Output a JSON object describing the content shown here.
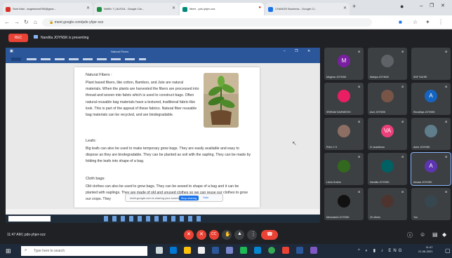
{
  "browser": {
    "tabs": [
      {
        "label": "Sent Mail - angelsmart786@gma..."
      },
      {
        "label": "Netflix 7 | ALEXA - Google Cla..."
      },
      {
        "label": "Meet - pdx-yhjer-ozz",
        "active": true
      },
      {
        "label": "CHANGE Business - Google Cl..."
      }
    ],
    "url": "meet.google.com/pdx-yhjer-ozz"
  },
  "meet": {
    "rec_label": "REC",
    "presenting_text": "Nandita JOYNSK is presenting",
    "meeting_info": "11:47 AM | pdx-yhjer-ozz",
    "share_banner": {
      "message": "meet.google.com is sharing your screen.",
      "stop_label": "Stop sharing",
      "hide_label": "Hide"
    }
  },
  "document": {
    "title": "Natural Fibers",
    "heading_fibers": "Natural Fibers :",
    "para_fibers": "Plant based fibers, like cotton, Bamboo, and Jute are natural materials. When the plants are harvested the fibers are processed into thread and woven into fabric which is used to construct bags. Often natural reusable bag materials have a textured, traditional fabric-like look. This is part of the appeal of these fabrics. Natural fiber reusable bag materials can be recycled, and are biodegradable.",
    "heading_leafs": "Leafs:",
    "para_leafs": "Big leafs can also be used to make temporary grow bags. They are easily available and easy to dispose as they are biodegradable. They can be planted as soil with the sapling. They can be made by folding the leafs into shape of a bag.",
    "heading_cloth": "Cloth bags:",
    "para_cloth": "Old clothes can also be used to grow bags. They can be sewed to shape of a bag and it can be planted with saplings. They are made of old and unused clothes so we can reuse our clothes to grow our crops. They"
  },
  "participants": [
    {
      "name": "Meghna JOYNSK",
      "initial": "M",
      "color": "#7b1fa2"
    },
    {
      "name": "Mahiya JOYNSK",
      "initial": "",
      "color": "#5f6368"
    },
    {
      "name": "SDF SUHRI",
      "initial": "",
      "color": "#3c4043"
    },
    {
      "name": "SRIRAM SAHNEESH",
      "initial": "",
      "color": "#e91e63"
    },
    {
      "name": "Avni JOYNSK",
      "initial": "",
      "color": "#795548"
    },
    {
      "name": "Shradhya JOYNSK",
      "initial": "A",
      "color": "#1565c0"
    },
    {
      "name": "Pritvi C S",
      "initial": "",
      "color": "#8d6e63"
    },
    {
      "name": "Vr ananthcsn",
      "initial": "VA",
      "color": "#ec407a"
    },
    {
      "name": "Ashe JOYNSK",
      "initial": "",
      "color": "#607d8b"
    },
    {
      "name": "Lisha Gratna",
      "initial": "",
      "color": "#33691e"
    },
    {
      "name": "Nandita JOYNSK",
      "initial": "",
      "color": "#006064"
    },
    {
      "name": "Aksara JOYNSK",
      "initial": "A",
      "color": "#5e35b1"
    },
    {
      "name": "Meenakshi JOYNSK",
      "initial": "",
      "color": "#111111"
    },
    {
      "name": "20 others",
      "initial": "",
      "color": "#4e342e"
    },
    {
      "name": "You",
      "initial": "",
      "color": "#37474f"
    }
  ],
  "taskbar": {
    "search_placeholder": "Type here to search",
    "time": "11:47",
    "date": "21-06-2021"
  },
  "colors": {
    "meet_bg": "#202124",
    "word_blue": "#2b579a",
    "end_call": "#ea4335"
  }
}
